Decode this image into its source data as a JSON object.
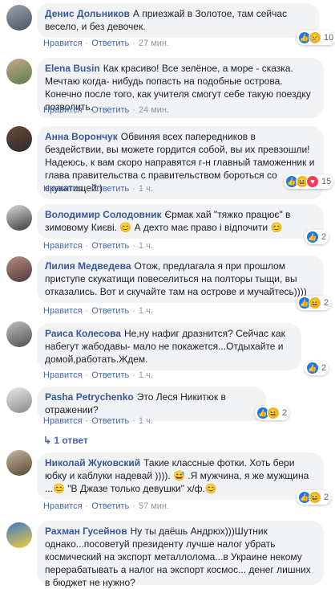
{
  "actions": {
    "like": "Нравится",
    "reply": "Ответить",
    "sep": "·"
  },
  "comments": [
    {
      "author": "Денис Дольников",
      "text": "А приезжай в Золотое, там сейчас весело, и без девочек.",
      "time": "27 мин.",
      "reactions": [
        "like",
        "sad"
      ],
      "count": "10"
    },
    {
      "author": "Elena Busin",
      "text": "Как красиво! Все зелёное, а море - сказка. Мечтаю когда- нибудь попасть на подобные острова. Конечно после того, как учителя смогут себе такую поездку позволить.",
      "time": "24 мин."
    },
    {
      "author": "Анна Ворончук",
      "text": "Обвиняя всех папередников в бездействии, вы можете гордится собой, вы их превзошли! Надеюсь, к вам скоро направятся г-н главный таможенник и глава правительства с правительством бороться со скукатищей:)",
      "time": "1 ч.",
      "reactions": [
        "like",
        "haha",
        "love"
      ],
      "count": "15"
    },
    {
      "author": "Володимир Солодовник",
      "text": "Єрмак хай \"тяжко працює\" в зимовому Києві. 😊 А дехто має право і відпочити 😊",
      "time": "1 ч.",
      "reactions": [
        "like"
      ],
      "count": "2"
    },
    {
      "author": "Лилия Медведева",
      "text": "Отож, предлагала я при прошлом приступе скукатищи повеселиться на полторы тыщи, вы отказались. Вот и скучайте там на острове и мучайтесь))))",
      "time": "1 ч.",
      "reactions": [
        "like",
        "haha"
      ],
      "count": "2"
    },
    {
      "author": "Раиса Колесова",
      "text": "Не,ну нафиг дразнится? Сейчас как набегут жабодавы- мало не покажется...Отдыхайте и домой,работать.Ждем.",
      "time": "1 ч.",
      "reactions": [
        "like"
      ],
      "count": "2"
    },
    {
      "author": "Pasha Petrychenko",
      "text": "Это Леся Никитюк в отражении?",
      "time": "1 ч.",
      "reactions": [
        "like",
        "haha"
      ],
      "count": "2",
      "replies": "1 ответ"
    },
    {
      "author": "Николай Жуковский",
      "text": "Такие классные фотки. Хоть бери юбку и каблуки надевай )))). 😅 .Я мужчина, я же мужщина ...😊 \"В Джазе только девушки\" х/ф.😊",
      "time": "57 мин.",
      "reactions": [
        "like",
        "haha"
      ],
      "count": "2"
    },
    {
      "author": "Рахман Гусейнов",
      "text": "Ну ты даёшь Андрюх)))Шутник однако...посоветуй президенту лучше налог убрать космический на экспорт металлолома...в Украине некому перерабатывать а налог на экспорт космос... денег лишних в бюджет не нужно?"
    }
  ],
  "colors": {
    "link": "#385898",
    "meta": "#90949c",
    "bubble": "#f2f3f5"
  }
}
